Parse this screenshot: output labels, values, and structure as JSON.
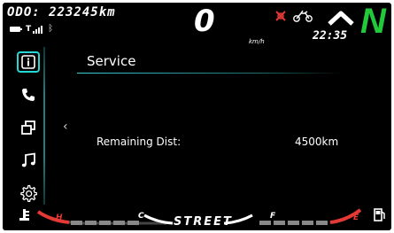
{
  "status": {
    "odometer": "ODO: 223245km",
    "speed": "0",
    "speed_unit": "km/h",
    "clock": "22:35",
    "gear": "N"
  },
  "sidebar": {
    "items": [
      {
        "name": "info",
        "icon": "info-icon",
        "active": true
      },
      {
        "name": "phone",
        "icon": "phone-icon",
        "active": false
      },
      {
        "name": "windows",
        "icon": "windows-icon",
        "active": false
      },
      {
        "name": "music",
        "icon": "music-note-icon",
        "active": false
      },
      {
        "name": "settings",
        "icon": "gear-icon",
        "active": false
      }
    ]
  },
  "page": {
    "title": "Service",
    "rows": [
      {
        "label": "Remaining Dist:",
        "value": "4500km"
      }
    ]
  },
  "bottom": {
    "mode": "STREET",
    "temp_hot_mark": "H",
    "temp_cold_mark": "C",
    "fuel_full_mark": "F",
    "fuel_empty_mark": "E"
  },
  "colors": {
    "accent": "#24d8d8",
    "gear_green": "#22c93a",
    "warning_red": "#e53935",
    "background": "#000000"
  }
}
